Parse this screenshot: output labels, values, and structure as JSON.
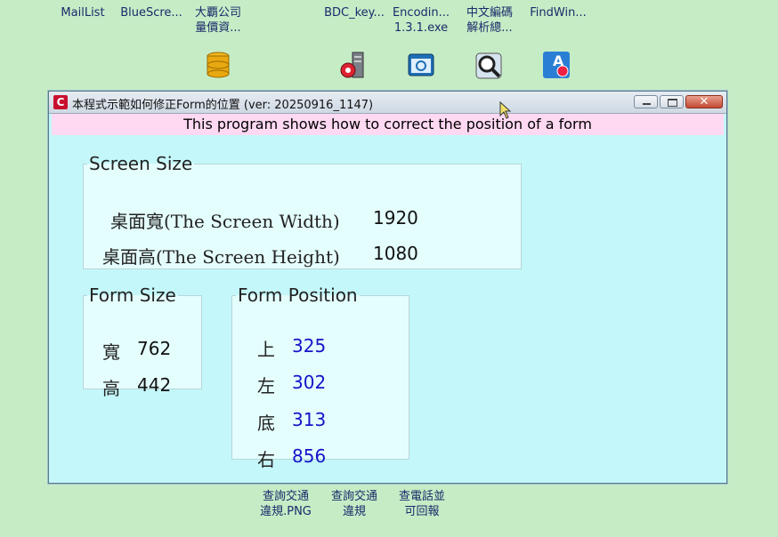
{
  "desktop": {
    "top_labels": [
      {
        "line1": "MailList",
        "line2": ""
      },
      {
        "line1": "BlueScre...",
        "line2": ""
      },
      {
        "line1": "大覇公司",
        "line2": "量價資..."
      },
      {
        "line1": "BDC_key...",
        "line2": ""
      },
      {
        "line1": "Encodin...",
        "line2": "1.3.1.exe"
      },
      {
        "line1": "中文編碼",
        "line2": "解析總..."
      },
      {
        "line1": "FindWin...",
        "line2": ""
      }
    ],
    "bottom_labels": [
      {
        "line1": "查詢交通",
        "line2": "違規.PNG"
      },
      {
        "line1": "查詢交通",
        "line2": "違規"
      },
      {
        "line1": "查電話並",
        "line2": "可回報"
      }
    ]
  },
  "window": {
    "app_icon_letter": "C",
    "title": "本程式示範如何修正Form的位置 (ver: 20250916_1147)",
    "close_glyph": "✕",
    "banner": "This program shows how to correct the position of a form",
    "screen_size": {
      "legend": "Screen Size",
      "width_label": "桌面寬(The Screen Width)",
      "width_value": "1920",
      "height_label": "桌面高(The Screen Height)",
      "height_value": "1080"
    },
    "form_size": {
      "legend": "Form Size",
      "width_label": "寬",
      "width_value": "762",
      "height_label": "高",
      "height_value": "442"
    },
    "form_position": {
      "legend": "Form Position",
      "top_label": "上",
      "top_value": "325",
      "left_label": "左",
      "left_value": "302",
      "bottom_label": "底",
      "bottom_value": "313",
      "right_label": "右",
      "right_value": "856"
    }
  },
  "colors": {
    "desktop_bg": "#c6ecc6",
    "window_bg": "#c4f7f9",
    "banner_bg": "#ffd9f2",
    "position_value": "#1414c8"
  }
}
